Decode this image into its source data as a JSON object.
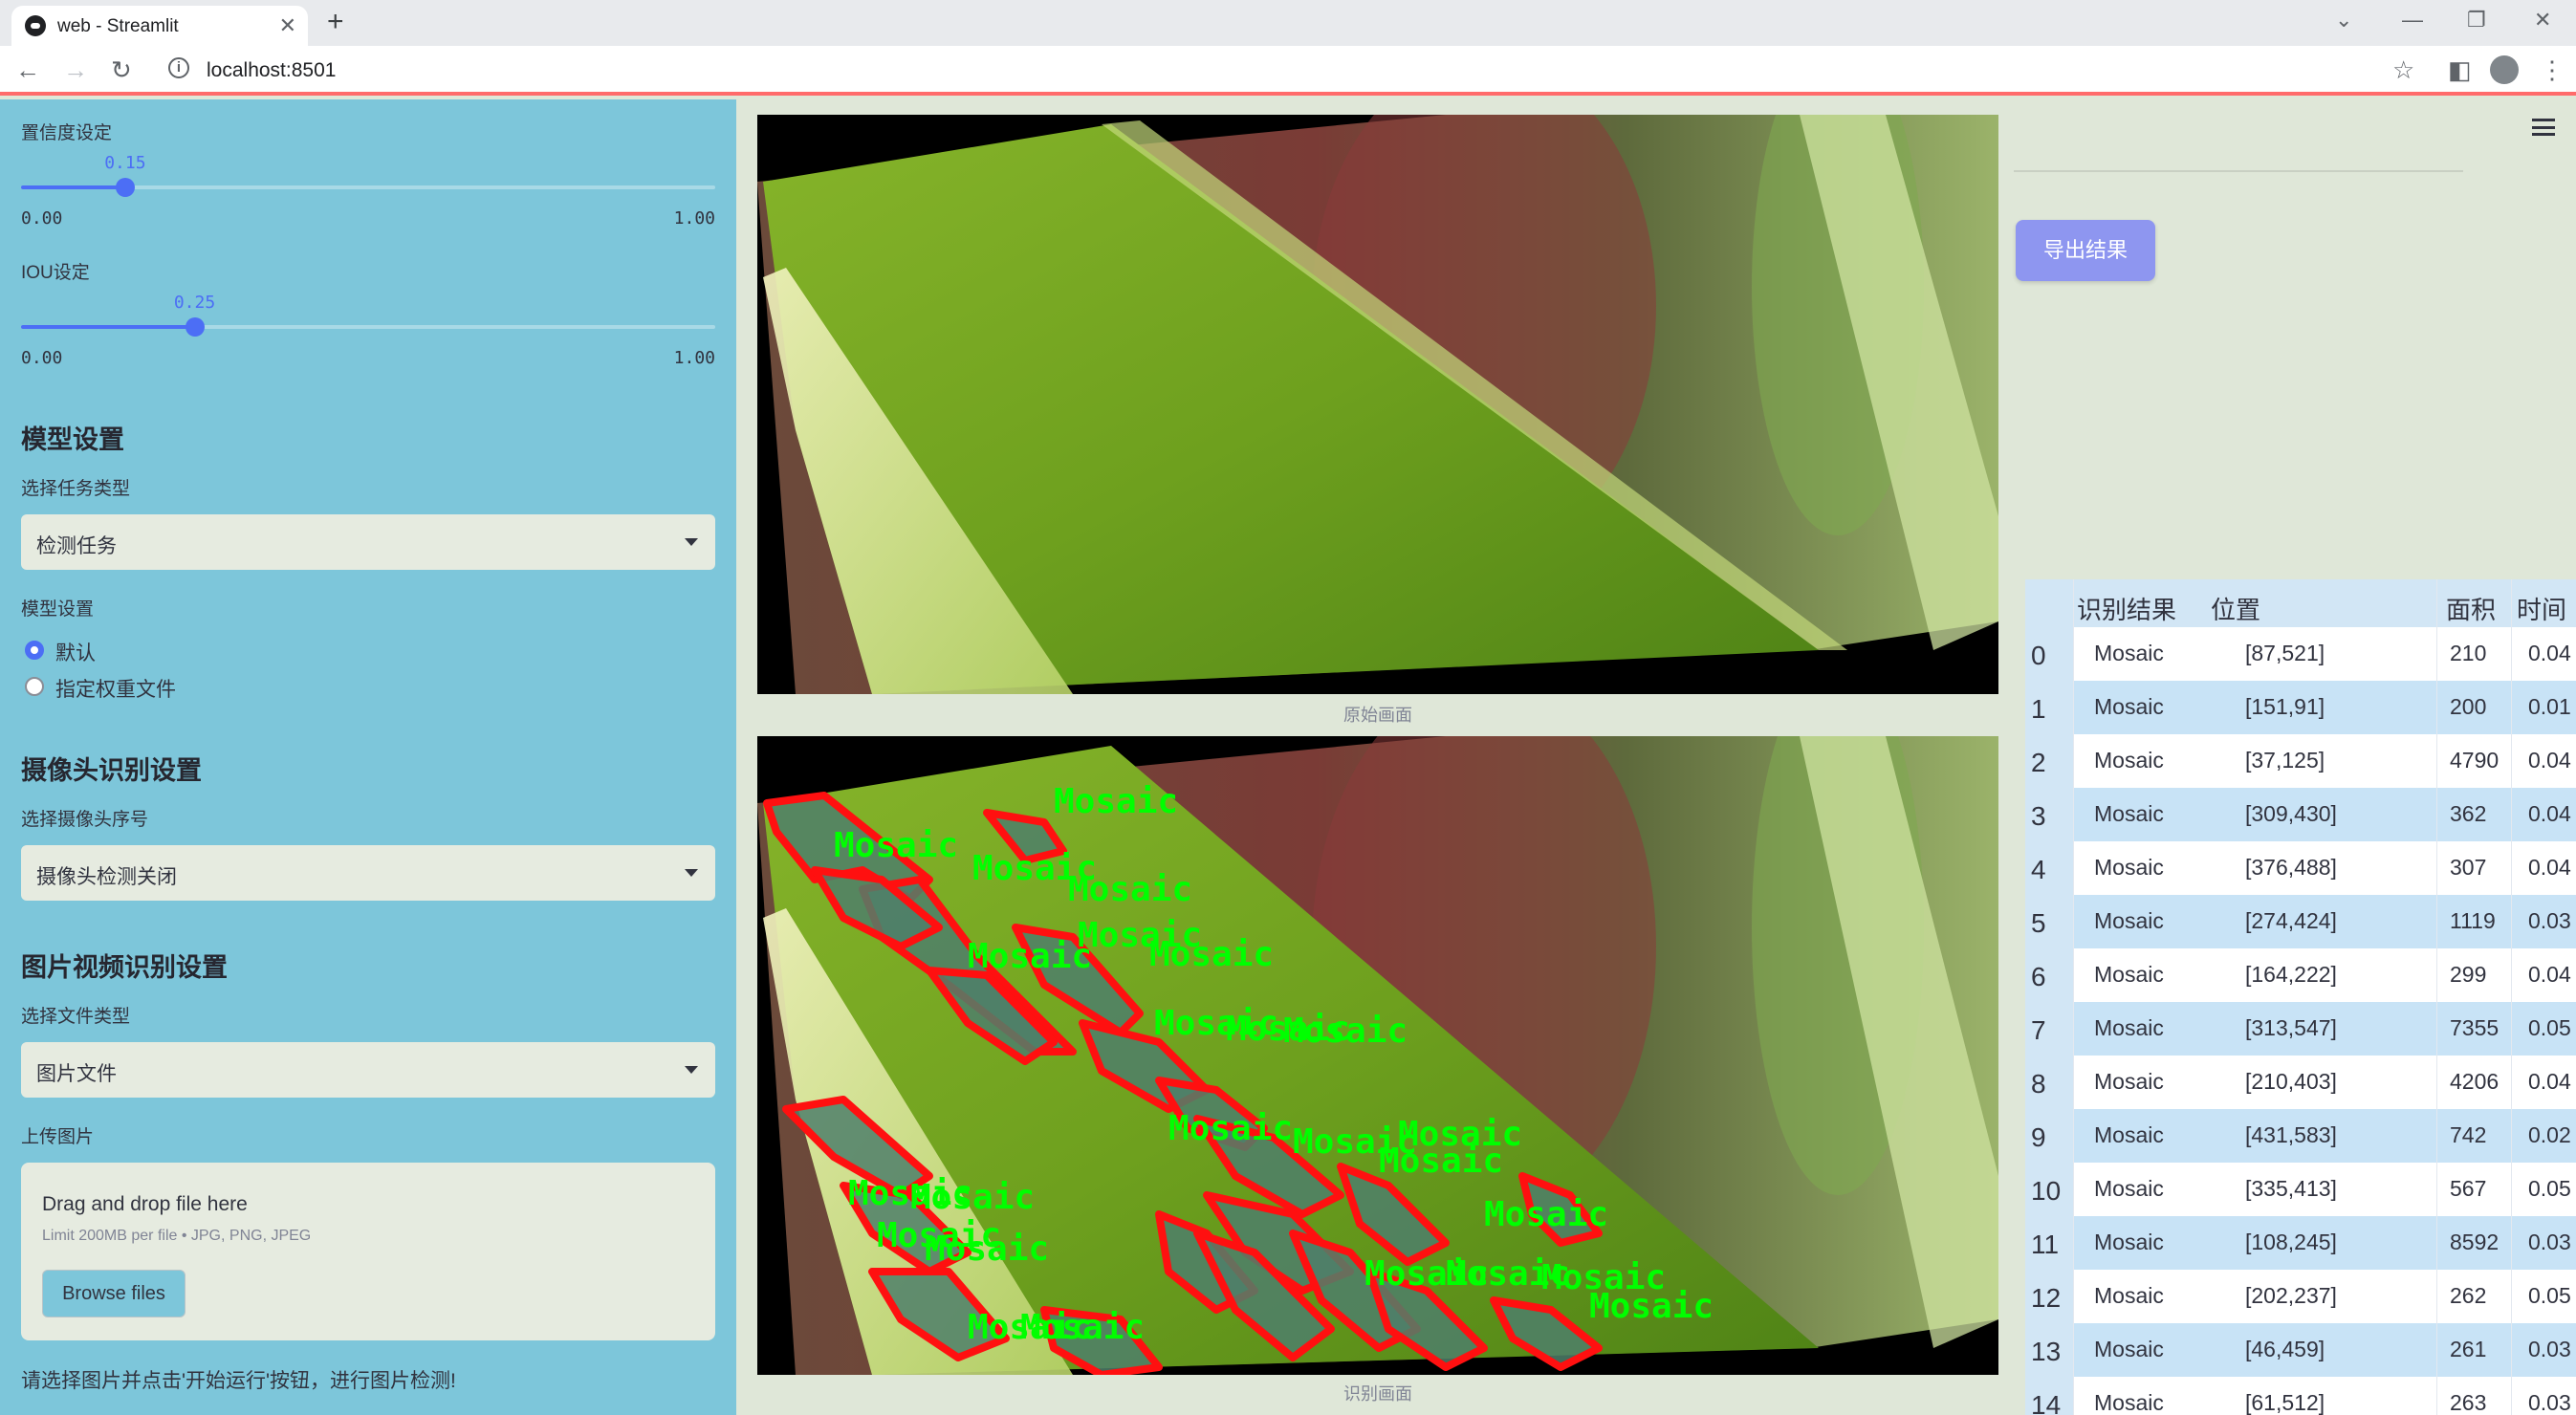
{
  "browser": {
    "tab_title": "web - Streamlit",
    "url": "localhost:8501"
  },
  "sidebar": {
    "confidence": {
      "label": "置信度设定",
      "value": "0.15",
      "min": "0.00",
      "max": "1.00",
      "fraction": 0.15
    },
    "iou": {
      "label": "IOU设定",
      "value": "0.25",
      "min": "0.00",
      "max": "1.00",
      "fraction": 0.25
    },
    "model_section": {
      "title": "模型设置",
      "task_label": "选择任务类型",
      "task_value": "检测任务",
      "model_label": "模型设置",
      "radio_default": "默认",
      "radio_custom": "指定权重文件"
    },
    "camera_section": {
      "title": "摄像头识别设置",
      "camera_label": "选择摄像头序号",
      "camera_value": "摄像头检测关闭"
    },
    "media_section": {
      "title": "图片视频识别设置",
      "file_type_label": "选择文件类型",
      "file_type_value": "图片文件",
      "upload_label": "上传图片",
      "drop_title": "Drag and drop file here",
      "drop_hint": "Limit 200MB per file • JPG, PNG, JPEG",
      "browse_label": "Browse files"
    },
    "info_text": "请选择图片并点击'开始运行'按钮，进行图片检测!"
  },
  "main": {
    "original_caption": "原始画面",
    "result_caption": "识别画面",
    "detection_label": "Mosaic"
  },
  "right": {
    "export_label": "导出结果",
    "table": {
      "headers": [
        "识别结果",
        "位置",
        "面积",
        "时间"
      ],
      "rows": [
        [
          "0",
          "Mosaic",
          "[87,521]",
          "210",
          "0.04"
        ],
        [
          "1",
          "Mosaic",
          "[151,91]",
          "200",
          "0.01"
        ],
        [
          "2",
          "Mosaic",
          "[37,125]",
          "4790",
          "0.04"
        ],
        [
          "3",
          "Mosaic",
          "[309,430]",
          "362",
          "0.04"
        ],
        [
          "4",
          "Mosaic",
          "[376,488]",
          "307",
          "0.04"
        ],
        [
          "5",
          "Mosaic",
          "[274,424]",
          "1119",
          "0.03"
        ],
        [
          "6",
          "Mosaic",
          "[164,222]",
          "299",
          "0.04"
        ],
        [
          "7",
          "Mosaic",
          "[313,547]",
          "7355",
          "0.05"
        ],
        [
          "8",
          "Mosaic",
          "[210,403]",
          "4206",
          "0.04"
        ],
        [
          "9",
          "Mosaic",
          "[431,583]",
          "742",
          "0.02"
        ],
        [
          "10",
          "Mosaic",
          "[335,413]",
          "567",
          "0.05"
        ],
        [
          "11",
          "Mosaic",
          "[108,245]",
          "8592",
          "0.03"
        ],
        [
          "12",
          "Mosaic",
          "[202,237]",
          "262",
          "0.05"
        ],
        [
          "13",
          "Mosaic",
          "[46,459]",
          "261",
          "0.03"
        ],
        [
          "14",
          "Mosaic",
          "[61,512]",
          "263",
          "0.03"
        ]
      ]
    }
  }
}
